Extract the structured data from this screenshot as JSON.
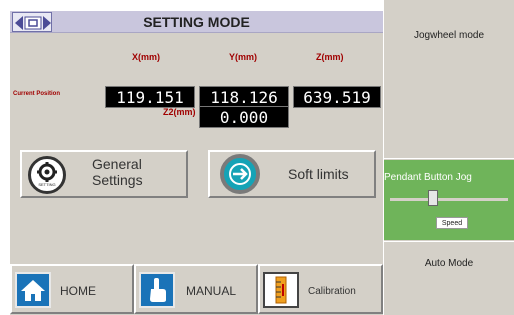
{
  "header": {
    "title": "SETTING MODE"
  },
  "axes": {
    "x_label": "X(mm)",
    "y_label": "Y(mm)",
    "z_label": "Z(mm)",
    "z2_label": "Z2(mm)",
    "current_position_label": "Current Position"
  },
  "position": {
    "x": "119.151",
    "y": "118.126",
    "z": "639.519",
    "z2": "0.000"
  },
  "buttons": {
    "general_settings": "General\nSettings",
    "general_settings_icon_text": "SETTING",
    "soft_limits": "Soft limits"
  },
  "right_panel": {
    "jogwheel_mode": "Jogwheel mode",
    "pendant_button": "Pendant Button Jog",
    "speed_label": "Speed",
    "auto_mode": "Auto Mode"
  },
  "nav": {
    "home": "HOME",
    "manual": "MANUAL",
    "calibration": "Calibration"
  },
  "colors": {
    "header_bg": "#c9c6dd",
    "panel_bg": "#d4d0c8",
    "value_bg": "#000000",
    "axis_red": "#a00000",
    "pendant_green": "#6fb45a",
    "nav_blue": "#1a73b8"
  },
  "icons": {
    "logo": "logo-icon",
    "general_settings": "settings-gear-icon",
    "soft_limits": "arrow-right-circle-icon",
    "home": "home-icon",
    "manual": "hand-pointer-icon",
    "calibration": "calibration-ruler-icon"
  }
}
